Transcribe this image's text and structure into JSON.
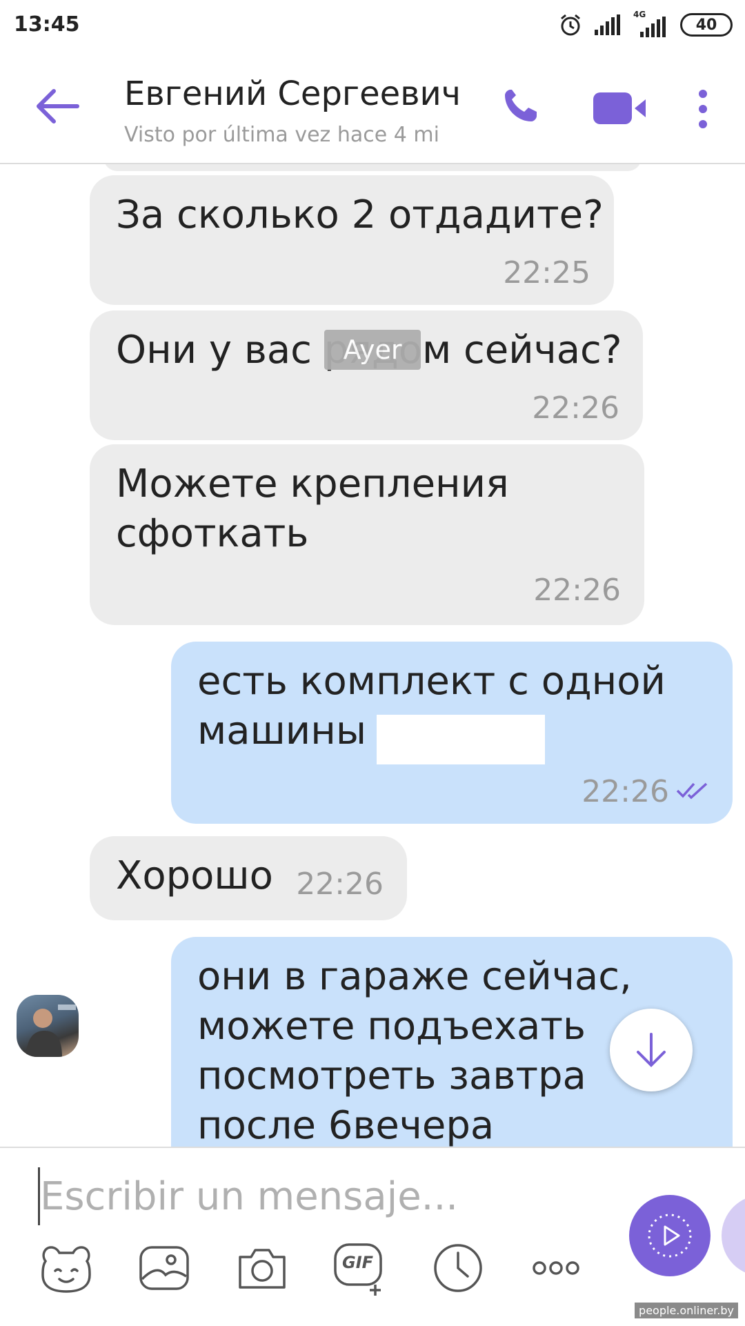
{
  "status_bar": {
    "time": "13:45",
    "network": "4G",
    "battery": "40"
  },
  "header": {
    "contact_name": "Евгений Сергеевич",
    "last_seen": "Visto por última vez hace 4 mi"
  },
  "chat": {
    "date_chip": "Ayer",
    "messages": [
      {
        "direction": "in",
        "lines": [
          "За сколько 2 отдадите?"
        ],
        "time": "22:25"
      },
      {
        "direction": "in",
        "lines": [
          "Они у вас рядом сейчас?"
        ],
        "time": "22:26"
      },
      {
        "direction": "in",
        "lines": [
          "Можете крепления",
          "сфоткать"
        ],
        "time": "22:26"
      },
      {
        "direction": "out",
        "lines": [
          "есть комплект с одной",
          "машины"
        ],
        "time": "22:26",
        "status": "read"
      },
      {
        "direction": "in",
        "lines": [
          "Хорошо"
        ],
        "time": "22:26"
      },
      {
        "direction": "out",
        "lines": [
          "они в гараже сейчас,",
          "можете подъехать",
          "посмотреть завтра",
          "после 6вечера"
        ]
      }
    ]
  },
  "composer": {
    "placeholder": "Escribir un mensaje...",
    "tools": [
      "sticker-icon",
      "gallery-icon",
      "camera-icon",
      "gif-icon",
      "clock-icon",
      "more-options-icon"
    ],
    "gif_label": "GIF"
  },
  "watermark": "people.onliner.by",
  "colors": {
    "accent": "#7b61d8",
    "incoming": "#ececec",
    "outgoing": "#c9e1fb",
    "meta": "#9a9a9a"
  }
}
